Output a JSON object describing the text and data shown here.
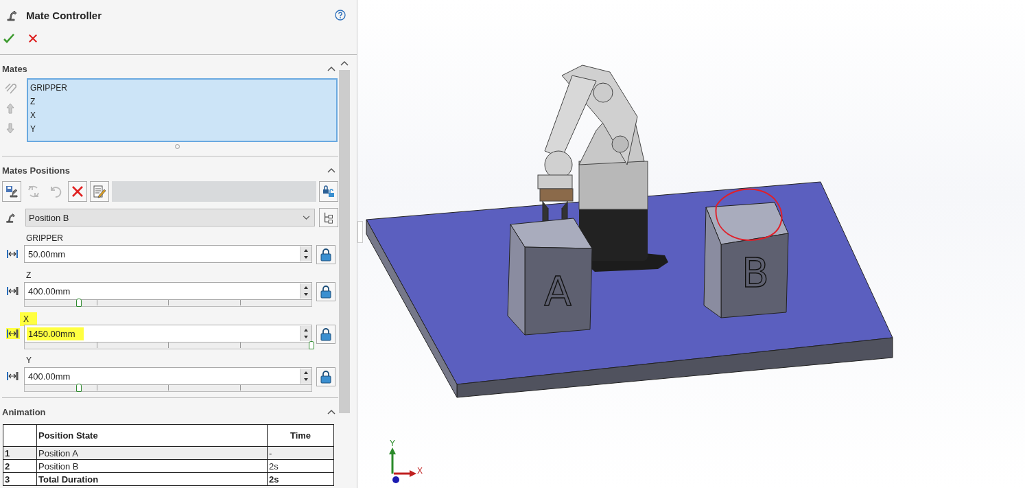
{
  "panel": {
    "title": "Mate Controller"
  },
  "mates": {
    "header": "Mates",
    "items": [
      "GRIPPER",
      "Z",
      "X",
      "Y"
    ]
  },
  "positions": {
    "header": "Mates Positions",
    "selected_position": "Position B",
    "mates": [
      {
        "label": "GRIPPER",
        "value": "50.00mm",
        "highlighted": false
      },
      {
        "label": "Z",
        "value": "400.00mm",
        "level": 0.19,
        "highlighted": false
      },
      {
        "label": "X",
        "value": "1450.00mm",
        "level": 1.0,
        "highlighted": true
      },
      {
        "label": "Y",
        "value": "400.00mm",
        "level": 0.19,
        "highlighted": false
      }
    ]
  },
  "animation": {
    "header": "Animation",
    "columns": [
      "Position State",
      "Time"
    ],
    "rows": [
      {
        "index": "1",
        "state": "Position A",
        "time": "-",
        "bold": false
      },
      {
        "index": "2",
        "state": "Position B",
        "time": "2s",
        "bold": false
      },
      {
        "index": "3",
        "state": "Total Duration",
        "time": "2s",
        "bold": true
      }
    ]
  },
  "viewport": {
    "blocks": [
      "A",
      "B"
    ],
    "axes": [
      "Y",
      "X"
    ]
  }
}
